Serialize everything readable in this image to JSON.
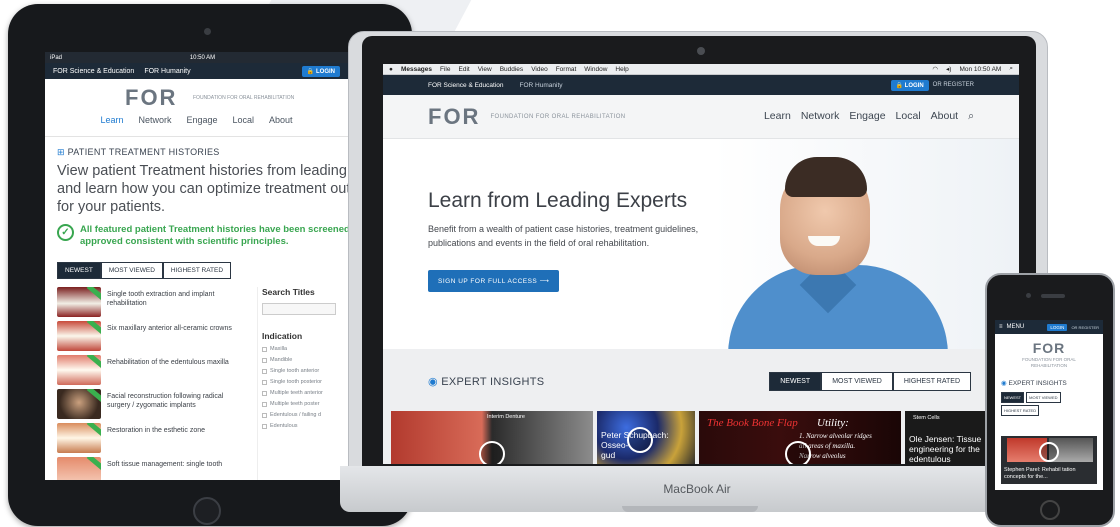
{
  "colors": {
    "brand_navy": "#1d2a38",
    "accent_blue": "#1f7bd0",
    "check_green": "#39a650"
  },
  "ipad": {
    "status": {
      "left": "iPad",
      "time": "10:50 AM"
    },
    "topbar": {
      "site_a": "FOR Science & Education",
      "site_b": "FOR Humanity",
      "login": "LOGIN"
    },
    "logo": "FOR",
    "logo_sub": "FOUNDATION FOR ORAL REHABILITATION",
    "nav": [
      "Learn",
      "Network",
      "Engage",
      "Local",
      "About"
    ],
    "section_title": "PATIENT TREATMENT HISTORIES",
    "intro_lines": [
      "View patient Treatment histories from leading ex",
      "and learn how you can optimize treatment outco",
      "for your patients."
    ],
    "approved_lines": [
      "All featured patient Treatment histories have been screened a",
      "approved consistent with scientific principles."
    ],
    "tabs": [
      "NEWEST",
      "MOST VIEWED",
      "HIGHEST RATED"
    ],
    "items": [
      "Single tooth extraction and implant rehabilitation",
      "Six maxillary anterior all-ceramic crowns",
      "Rehabilitation of the edentulous maxilla",
      "Facial reconstruction following radical surgery / zygomatic implants",
      "Restoration in the esthetic zone",
      "Soft tissue management: single tooth"
    ],
    "side": {
      "search_title": "Search Titles",
      "indication": "Indication",
      "options": [
        "Maxilla",
        "Mandible",
        "Single tooth anterior",
        "Single tooth posterior",
        "Multiple teeth anterior",
        "Multiple teeth poster",
        "Edentulous / failing d",
        "Edentulous"
      ]
    }
  },
  "mac": {
    "menubar": {
      "apple": "",
      "app": "Messages",
      "menus": [
        "File",
        "Edit",
        "View",
        "Buddies",
        "Video",
        "Format",
        "Window",
        "Help"
      ],
      "clock": "Mon 10:50 AM"
    },
    "topbar": {
      "site_a": "FOR Science & Education",
      "site_b": "FOR Humanity",
      "login": "LOGIN",
      "or_register": "OR REGISTER"
    },
    "logo": "FOR",
    "logo_sub": "FOUNDATION FOR ORAL REHABILITATION",
    "nav": [
      "Learn",
      "Network",
      "Engage",
      "Local",
      "About"
    ],
    "hero": {
      "title": "Learn from Leading Experts",
      "body": "Benefit from a wealth of patient case histories, treatment guidelines, publications and events in the field of oral rehabilitation.",
      "cta": "SIGN UP FOR FULL ACCESS ⟶"
    },
    "insights": {
      "title": "EXPERT INSIGHTS",
      "tabs": [
        "NEWEST",
        "MOST VIEWED",
        "HIGHEST RATED"
      ],
      "cards": [
        {
          "tag": "Interim Denture",
          "caption": ""
        },
        {
          "caption_lines": [
            "Peter Schupbach: Osseo-",
            "gud"
          ]
        },
        {
          "book": "The Book Bone Flap",
          "utility": "Utility:",
          "lines": [
            "1. Narrow alveolar ridges",
            "all areas of maxilla.",
            "Narrow alveolus"
          ]
        },
        {
          "tag": "Stem Cells",
          "caption_lines": [
            "Ole Jensen: Tissue",
            "engineering for the",
            "edentulous"
          ]
        }
      ]
    },
    "brand": "MacBook Air"
  },
  "iphone": {
    "menu": "MENU",
    "login": "LOGIN",
    "or_register": "OR REGISTER",
    "logo": "FOR",
    "logo_sub_lines": [
      "FOUNDATION FOR ORAL",
      "REHABILITATION"
    ],
    "insights": "EXPERT INSIGHTS",
    "tabs": [
      "NEWEST",
      "MOST VIEWED",
      "HIGHEST RATED"
    ],
    "card_caption_lines": [
      "Stephen Parel: Rehabil tation",
      "concepts for the..."
    ]
  }
}
